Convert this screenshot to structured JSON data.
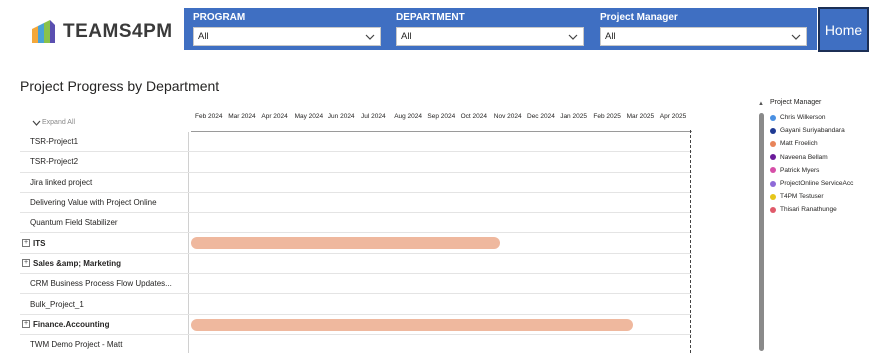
{
  "brand": {
    "name": "TEAMS4PM"
  },
  "filters": [
    {
      "label": "PROGRAM",
      "value": "All"
    },
    {
      "label": "DEPARTMENT",
      "value": "All"
    },
    {
      "label": "Project Manager",
      "value": "All"
    }
  ],
  "home_label": "Home",
  "title": "Project Progress by Department",
  "gantt": {
    "expand_all": "Expand All",
    "timeline": [
      "Feb 2024",
      "Mar 2024",
      "Apr 2024",
      "May 2024",
      "Jun 2024",
      "Jul 2024",
      "Aug 2024",
      "Sep 2024",
      "Oct 2024",
      "Nov 2024",
      "Dec 2024",
      "Jan 2025",
      "Feb 2025",
      "Mar 2025",
      "Apr 2025"
    ],
    "rows": [
      {
        "label": "TSR-Project1",
        "group": false
      },
      {
        "label": "TSR-Project2",
        "group": false
      },
      {
        "label": "Jira linked project",
        "group": false
      },
      {
        "label": "Delivering Value with Project Online",
        "group": false
      },
      {
        "label": "Quantum Field Stabilizer",
        "group": false
      },
      {
        "label": "ITS",
        "group": true,
        "bar_start": "Jan 2024",
        "bar_end": "Nov 2024"
      },
      {
        "label": "Sales &amp; Marketing",
        "group": true
      },
      {
        "label": "CRM Business Process Flow Updates...",
        "group": false
      },
      {
        "label": "Bulk_Project_1",
        "group": false
      },
      {
        "label": "Finance.Accounting",
        "group": true,
        "bar_start": "Jan 2024",
        "bar_end": "Mar 2025"
      },
      {
        "label": "TWM Demo Project - Matt",
        "group": false
      }
    ]
  },
  "legend": {
    "title": "Project Manager",
    "items": [
      {
        "name": "Chris Wilkerson",
        "color": "#4a90e2"
      },
      {
        "name": "Gayani Suriyabandara",
        "color": "#1f3a93"
      },
      {
        "name": "Matt Froelich",
        "color": "#e8845a"
      },
      {
        "name": "Naveena Bellam",
        "color": "#6a1b9a"
      },
      {
        "name": "Patrick Myers",
        "color": "#d64fa8"
      },
      {
        "name": "ProjectOnline ServiceAcc",
        "color": "#8e6ad8"
      },
      {
        "name": "T4PM Testuser",
        "color": "#e6c619"
      },
      {
        "name": "Thisari Ranathunge",
        "color": "#e05a6a"
      }
    ]
  },
  "colors": {
    "filter_bar": "#3f6fc2",
    "bar": "#efb89e"
  }
}
